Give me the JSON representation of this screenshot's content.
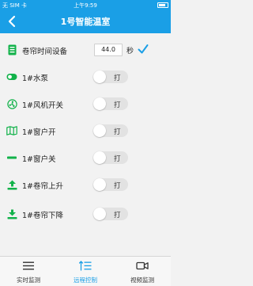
{
  "status_bar": {
    "carrier": "无 SIM 卡",
    "time": "上午9:59",
    "battery": ""
  },
  "nav": {
    "title": "1号智能温室",
    "back": "‹"
  },
  "timer": {
    "label": "卷帘时间设备",
    "value": "44.0",
    "unit": "秒"
  },
  "rows": [
    {
      "label": "1#水泵",
      "icon": "toggle-icon",
      "state": "打"
    },
    {
      "label": "1#风机开关",
      "icon": "fan-icon",
      "state": "打"
    },
    {
      "label": "1#窗户开",
      "icon": "map-icon",
      "state": "打"
    },
    {
      "label": "1#窗户关",
      "icon": "minus-icon",
      "state": "打"
    },
    {
      "label": "1#卷帘上升",
      "icon": "upload-icon",
      "state": "打"
    },
    {
      "label": "1#卷帘下降",
      "icon": "download-icon",
      "state": "打"
    }
  ],
  "tabs": [
    {
      "label": "实时监测",
      "icon": "list-icon",
      "active": false
    },
    {
      "label": "远程控制",
      "icon": "sort-list-icon",
      "active": true
    },
    {
      "label": "视频监测",
      "icon": "video-icon",
      "active": false
    }
  ],
  "colors": {
    "primary": "#1a9fe6",
    "icon_green": "#12b24a",
    "toggle_off": "#e2e2e2"
  }
}
